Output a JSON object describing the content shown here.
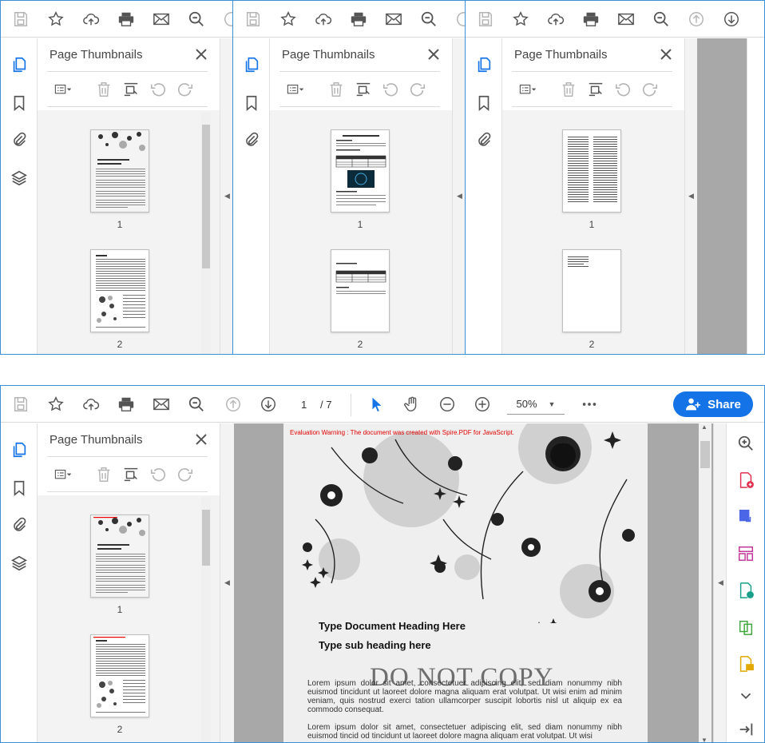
{
  "panel": {
    "title": "Page Thumbnails"
  },
  "thumbnails": {
    "win1": [
      {
        "num": "1"
      },
      {
        "num": "2"
      }
    ],
    "win2": [
      {
        "num": "1"
      },
      {
        "num": "2"
      }
    ],
    "win3": [
      {
        "num": "1"
      },
      {
        "num": "2"
      }
    ],
    "win4": [
      {
        "num": "1"
      },
      {
        "num": "2"
      }
    ]
  },
  "nav": {
    "current_page": "1",
    "total_pages": "/ 7",
    "zoom": "50%"
  },
  "share": {
    "label": "Share"
  },
  "document": {
    "eval_warning": "Evaluation Warning : The document was created with Spire.PDF for JavaScript.",
    "heading": "Type Document Heading Here",
    "subheading": "Type sub heading here",
    "watermark": "DO NOT COPY",
    "para1": "Lorem ipsum dolor sit amet, consectetuer adipiscing elit, sed diam nonummy nibh euismod tincidunt ut laoreet dolore magna aliquam erat volutpat. Ut wisi enim ad minim veniam, quis nostrud exerci tation ullamcorper suscipit lobortis nisl ut aliquip ex ea commodo consequat.",
    "para2": "Lorem ipsum dolor sit amet, consectetuer adipiscing elit, sed diam nonummy nibh euismod tincid od tincidunt ut laoreet dolore magna aliquam erat volutpat. Ut wisi"
  },
  "colors": {
    "accent": "#1473e6",
    "frame": "#3b8fd6",
    "icon": "#555555",
    "disabled": "#b5b5b5"
  }
}
